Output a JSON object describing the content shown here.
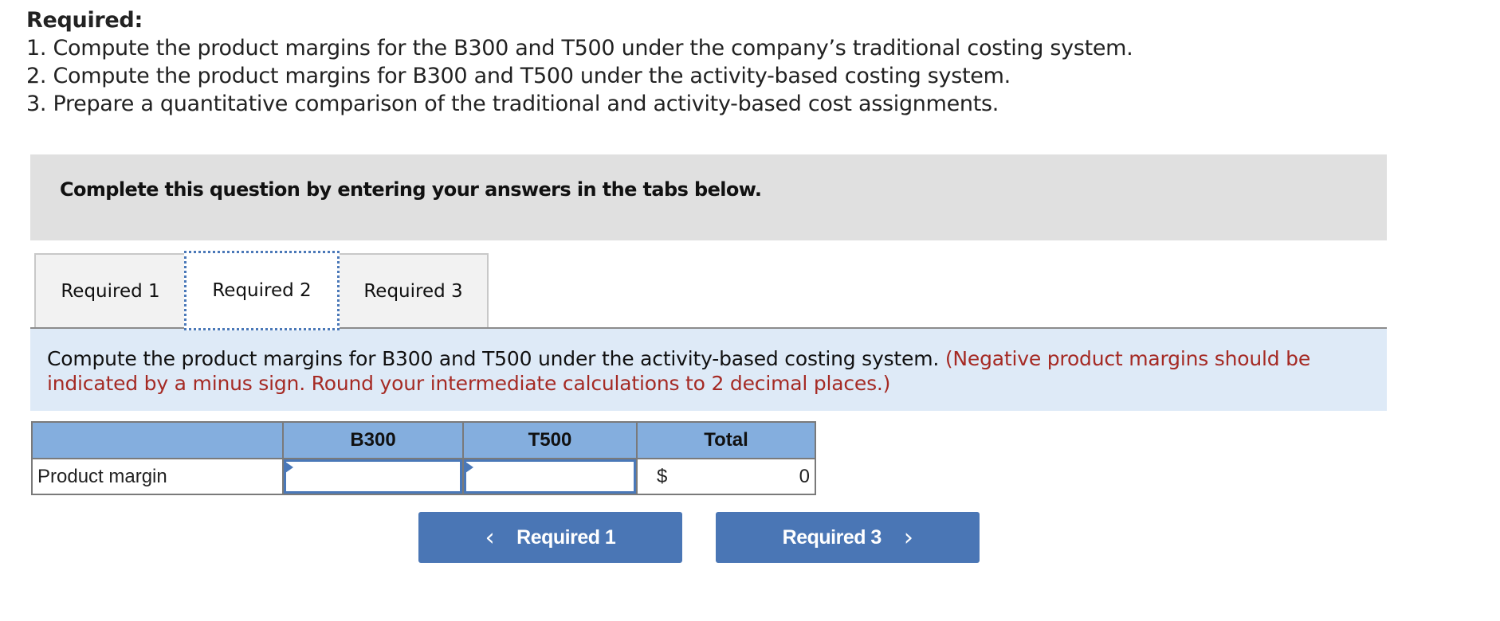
{
  "requirements": {
    "title": "Required:",
    "items": [
      "1. Compute the product margins for the B300 and T500 under the company’s traditional costing system.",
      "2. Compute the product margins for B300 and T500 under the activity-based costing system.",
      "3. Prepare a quantitative comparison of the traditional and activity-based cost assignments."
    ]
  },
  "banner": {
    "text": "Complete this question by entering your answers in the tabs below."
  },
  "tabs": [
    {
      "label": "Required 1",
      "active": false
    },
    {
      "label": "Required 2",
      "active": true
    },
    {
      "label": "Required 3",
      "active": false
    }
  ],
  "instruction": {
    "text": "Compute the product margins for B300 and T500 under the activity-based costing system.",
    "note": "(Negative product margins should be indicated by a minus sign. Round your intermediate calculations to 2 decimal places.)"
  },
  "table": {
    "headers": [
      "",
      "B300",
      "T500",
      "Total"
    ],
    "rows": [
      {
        "label": "Product margin",
        "b300_value": "",
        "t500_value": "",
        "total_currency": "$",
        "total_value": "0"
      }
    ]
  },
  "nav": {
    "prev_label": "Required 1",
    "next_label": "Required 3",
    "prev_icon": "‹",
    "next_icon": "›"
  },
  "colors": {
    "button_bg": "#4a76b5",
    "header_bg": "#84aede",
    "instruction_bg": "#deeaf7",
    "note_color": "#a52a24",
    "banner_bg": "#e0e0e0"
  }
}
